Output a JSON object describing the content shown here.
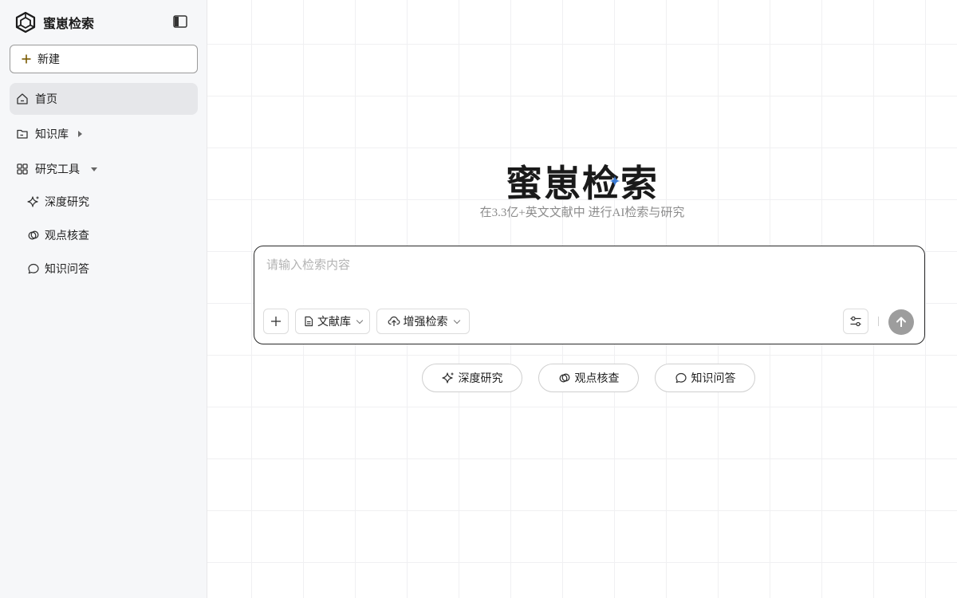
{
  "sidebar": {
    "brand_name": "蜜崽检索",
    "new_label": "新建",
    "nav": {
      "home": "首页",
      "knowledge": "知识库",
      "research_tools": "研究工具",
      "deep_research": "深度研究",
      "claim_check": "观点核查",
      "knowledge_qa": "知识问答"
    },
    "icons": {
      "logo": "hexagon-logo-icon",
      "collapse": "sidebar-collapse-icon",
      "plus": "plus-icon",
      "home": "home-icon",
      "folder": "folder-icon",
      "grid": "grid-icon",
      "sparkle": "sparkle-icon",
      "check": "link-check-icon",
      "chat": "chat-bubble-icon"
    }
  },
  "main": {
    "title": "蜜崽检索",
    "subtitle": "在3.3亿+英文文献中 进行AI检索与研究",
    "search": {
      "placeholder": "请输入检索内容",
      "library_label": "文献库",
      "enhanced_label": "增强检索"
    },
    "quick_actions": [
      "深度研究",
      "观点核查",
      "知识问答"
    ]
  },
  "colors": {
    "brand_accent": "#7a5a00",
    "sparkle_blue": "#3a7bd5",
    "sidebar_bg": "#f6f7f9",
    "send_button": "#9d9d9d"
  }
}
